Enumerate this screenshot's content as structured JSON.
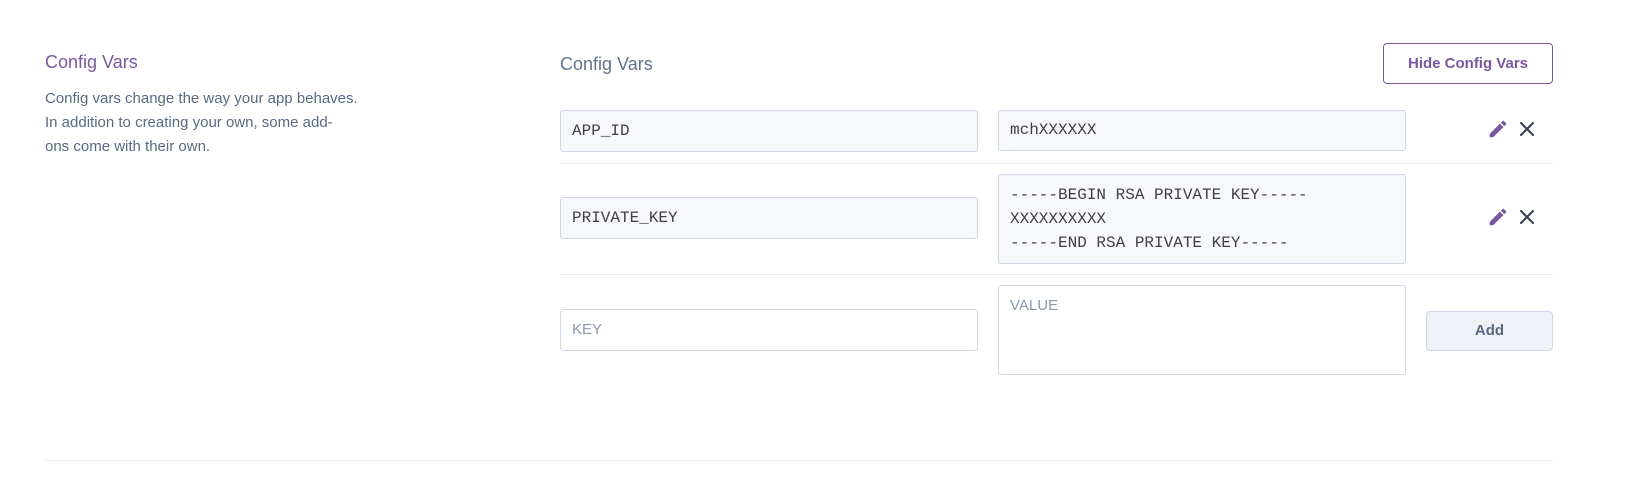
{
  "sidebar": {
    "title": "Config Vars",
    "description": "Config vars change the way your app behaves.\nIn addition to creating your own, some add-\nons come with their own."
  },
  "main": {
    "title": "Config Vars",
    "hide_button_label": "Hide Config Vars",
    "vars": [
      {
        "key": "APP_ID",
        "value": "mchXXXXXX"
      },
      {
        "key": "PRIVATE_KEY",
        "value": "-----BEGIN RSA PRIVATE KEY-----\nXXXXXXXXXX\n-----END RSA PRIVATE KEY-----"
      }
    ],
    "new_var": {
      "key_placeholder": "KEY",
      "value_placeholder": "VALUE",
      "add_label": "Add"
    },
    "icons": {
      "edit": "pencil-icon",
      "delete": "close-icon"
    }
  },
  "colors": {
    "accent": "#79589f",
    "text_muted": "#596981",
    "border": "#cfd7e6",
    "field_bg": "#f7f8fb"
  }
}
